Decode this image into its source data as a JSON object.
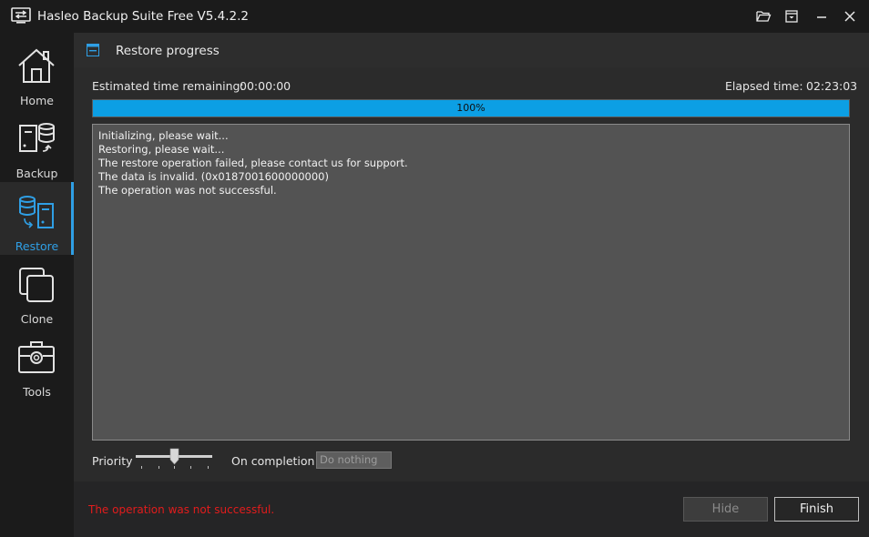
{
  "window": {
    "title": "Hasleo Backup Suite Free V5.4.2.2",
    "app_icon": "app-logo-icon",
    "controls": [
      "folder-open-icon",
      "download-icon",
      "minimize-icon",
      "close-icon"
    ]
  },
  "sidebar": {
    "items": [
      {
        "label": "Home",
        "icon": "home-icon",
        "active": false
      },
      {
        "label": "Backup",
        "icon": "backup-icon",
        "active": false
      },
      {
        "label": "Restore",
        "icon": "restore-icon",
        "active": true
      },
      {
        "label": "Clone",
        "icon": "clone-icon",
        "active": false
      },
      {
        "label": "Tools",
        "icon": "toolbox-icon",
        "active": false
      }
    ],
    "collapse_icon": "double-chevron-left-icon"
  },
  "header": {
    "title": "Restore progress",
    "icon": "restore-progress-icon"
  },
  "progress": {
    "estimated_label": "Estimated time remaining:",
    "estimated_value": "00:00:00",
    "elapsed_label": "Elapsed time:",
    "elapsed_value": "02:23:03",
    "percent": 100,
    "percent_text": "100%"
  },
  "log": {
    "lines": [
      "Initializing, please wait...",
      "Restoring, please wait...",
      "The restore operation failed, please contact us for support.",
      "The data is invalid. (0x0187001600000000)",
      "The operation was not successful."
    ]
  },
  "options": {
    "priority_label": "Priority",
    "on_completion_label": "On completion",
    "on_completion_value": "Do nothing"
  },
  "footer": {
    "status_message": "The operation was not successful.",
    "hide_label": "Hide",
    "finish_label": "Finish"
  },
  "colors": {
    "accent": "#2f9fe5",
    "progress_fill": "#0c9fe4",
    "error": "#e21c1c"
  }
}
